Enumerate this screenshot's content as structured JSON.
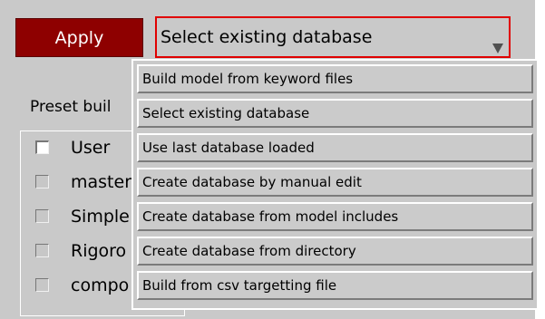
{
  "toolbar": {
    "apply_label": "Apply"
  },
  "database_select": {
    "selected_value": "Select existing database",
    "arrow_icon": "triangle-down-icon",
    "border_color": "#e00000"
  },
  "apply_button": {
    "background_color": "#8e0000"
  },
  "preset": {
    "label": "Preset buil",
    "items": [
      {
        "label": "User",
        "checked": false
      },
      {
        "label": "master",
        "checked": false
      },
      {
        "label": "Simple",
        "checked": false
      },
      {
        "label": "Rigoro",
        "checked": false
      },
      {
        "label": "compo",
        "checked": false
      }
    ]
  },
  "dropdown": {
    "options": [
      "Build model from keyword files",
      "Select existing database",
      "Use last database loaded",
      "Create database by manual edit",
      "Create database from model includes",
      "Create database from directory",
      "Build from csv targetting file"
    ]
  }
}
